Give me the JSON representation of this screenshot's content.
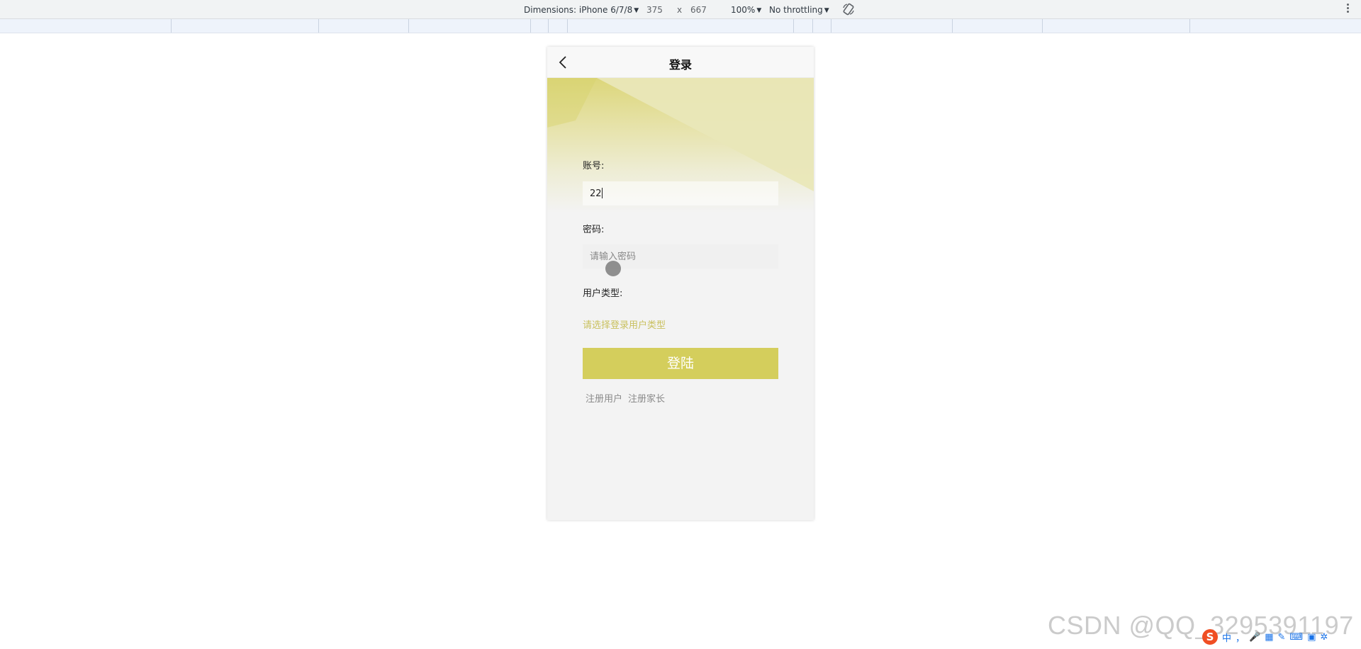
{
  "devtools": {
    "dimensions_label": "Dimensions: iPhone 6/7/8",
    "width_value": "375",
    "times_sign": "x",
    "height_value": "667",
    "zoom": "100%",
    "throttling": "No throttling"
  },
  "page": {
    "nav_title": "登录",
    "account_label": "账号:",
    "account_value": "22",
    "password_label": "密码:",
    "password_placeholder": "请输入密码",
    "user_type_label": "用户类型:",
    "user_type_placeholder": "请选择登录用户类型",
    "login_button": "登陆",
    "register_user": "注册用户",
    "register_parent": "注册家长"
  },
  "colors": {
    "accent": "#d4ce5c",
    "accent_text": "#c9c05e",
    "hero_light": "#e9e7b8",
    "hero_dark": "#dcd67a"
  },
  "watermark": "CSDN @QQ_3295391197",
  "ime_tray": {
    "logo": "S",
    "items": [
      "中",
      "，",
      "🎤",
      "▦",
      "✎",
      "⌨",
      "▣",
      "✲"
    ]
  }
}
